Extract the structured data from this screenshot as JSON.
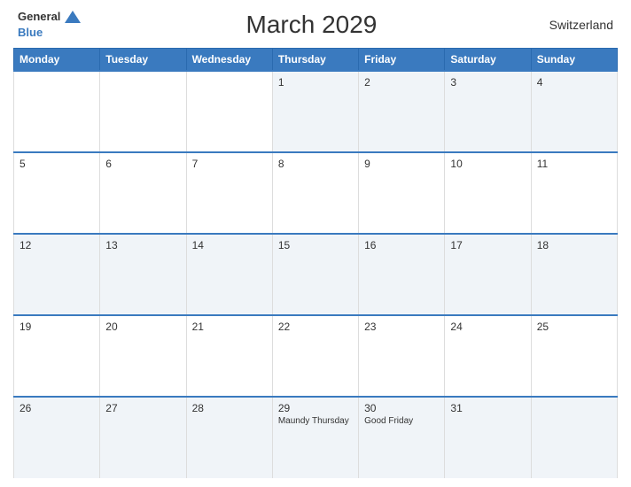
{
  "header": {
    "logo_general": "General",
    "logo_blue": "Blue",
    "title": "March 2029",
    "country": "Switzerland"
  },
  "days_of_week": [
    "Monday",
    "Tuesday",
    "Wednesday",
    "Thursday",
    "Friday",
    "Saturday",
    "Sunday"
  ],
  "weeks": [
    [
      {
        "number": "",
        "event": ""
      },
      {
        "number": "",
        "event": ""
      },
      {
        "number": "",
        "event": ""
      },
      {
        "number": "1",
        "event": ""
      },
      {
        "number": "2",
        "event": ""
      },
      {
        "number": "3",
        "event": ""
      },
      {
        "number": "4",
        "event": ""
      }
    ],
    [
      {
        "number": "5",
        "event": ""
      },
      {
        "number": "6",
        "event": ""
      },
      {
        "number": "7",
        "event": ""
      },
      {
        "number": "8",
        "event": ""
      },
      {
        "number": "9",
        "event": ""
      },
      {
        "number": "10",
        "event": ""
      },
      {
        "number": "11",
        "event": ""
      }
    ],
    [
      {
        "number": "12",
        "event": ""
      },
      {
        "number": "13",
        "event": ""
      },
      {
        "number": "14",
        "event": ""
      },
      {
        "number": "15",
        "event": ""
      },
      {
        "number": "16",
        "event": ""
      },
      {
        "number": "17",
        "event": ""
      },
      {
        "number": "18",
        "event": ""
      }
    ],
    [
      {
        "number": "19",
        "event": ""
      },
      {
        "number": "20",
        "event": ""
      },
      {
        "number": "21",
        "event": ""
      },
      {
        "number": "22",
        "event": ""
      },
      {
        "number": "23",
        "event": ""
      },
      {
        "number": "24",
        "event": ""
      },
      {
        "number": "25",
        "event": ""
      }
    ],
    [
      {
        "number": "26",
        "event": ""
      },
      {
        "number": "27",
        "event": ""
      },
      {
        "number": "28",
        "event": ""
      },
      {
        "number": "29",
        "event": "Maundy Thursday"
      },
      {
        "number": "30",
        "event": "Good Friday"
      },
      {
        "number": "31",
        "event": ""
      },
      {
        "number": "",
        "event": ""
      }
    ]
  ]
}
